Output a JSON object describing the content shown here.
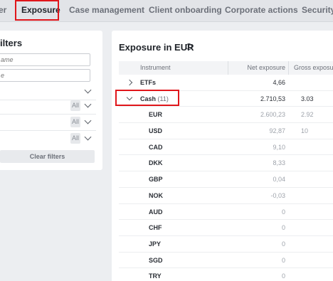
{
  "tabs": [
    {
      "label": "er",
      "active": false
    },
    {
      "label": "Exposure",
      "active": true
    },
    {
      "label": "Case management",
      "active": false
    },
    {
      "label": "Client onboarding",
      "active": false
    },
    {
      "label": "Corporate actions",
      "active": false
    },
    {
      "label": "Security",
      "active": false
    }
  ],
  "filters": {
    "title": "ilters",
    "name_placeholder": "ame",
    "second_placeholder": "e",
    "selects": [
      {
        "value": ""
      },
      {
        "value": "All"
      },
      {
        "value": "All"
      },
      {
        "value": "All"
      }
    ],
    "clear_label": "Clear filters"
  },
  "exposure": {
    "title": "Exposure in EUR",
    "columns": {
      "instrument": "Instrument",
      "net": "Net exposure",
      "gross": "Gross exposu"
    },
    "rows": [
      {
        "name": "ETFs",
        "count": "",
        "net": "4,66",
        "gross": "",
        "level": 0,
        "expanded": false
      },
      {
        "name": "Cash",
        "count": "(11)",
        "net": "2.710,53",
        "gross": "3.03",
        "level": 0,
        "expanded": true
      },
      {
        "name": "EUR",
        "net": "2.600,23",
        "gross": "2.92",
        "level": 1
      },
      {
        "name": "USD",
        "net": "92,87",
        "gross": "10",
        "level": 1
      },
      {
        "name": "CAD",
        "net": "9,10",
        "gross": "",
        "level": 1
      },
      {
        "name": "DKK",
        "net": "8,33",
        "gross": "",
        "level": 1
      },
      {
        "name": "GBP",
        "net": "0,04",
        "gross": "",
        "level": 1
      },
      {
        "name": "NOK",
        "net": "-0,03",
        "gross": "",
        "level": 1
      },
      {
        "name": "AUD",
        "net": "0",
        "gross": "",
        "level": 1
      },
      {
        "name": "CHF",
        "net": "0",
        "gross": "",
        "level": 1
      },
      {
        "name": "JPY",
        "net": "0",
        "gross": "",
        "level": 1
      },
      {
        "name": "SGD",
        "net": "0",
        "gross": "",
        "level": 1
      },
      {
        "name": "TRY",
        "net": "0",
        "gross": "",
        "level": 1
      }
    ]
  },
  "colors": {
    "highlight": "#e0161b",
    "background": "#eceef1"
  }
}
